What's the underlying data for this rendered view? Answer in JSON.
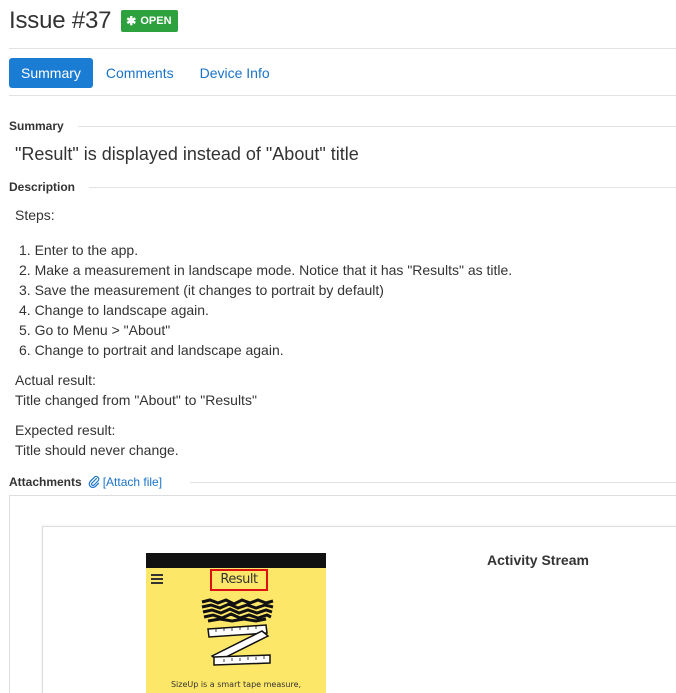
{
  "issue": {
    "title": "Issue #37",
    "status": "OPEN",
    "status_color": "#2ea13f"
  },
  "tabs": [
    {
      "label": "Summary",
      "active": true
    },
    {
      "label": "Comments",
      "active": false
    },
    {
      "label": "Device Info",
      "active": false
    }
  ],
  "summary": {
    "label": "Summary",
    "text": "\"Result\" is displayed instead of \"About\" title"
  },
  "description": {
    "label": "Description",
    "intro": "Steps:",
    "steps": [
      "1. Enter to the app.",
      "2. Make a measurement in landscape mode. Notice that it has \"Results\" as title.",
      "3. Save the measurement (it changes to portrait by default)",
      "4. Change to landscape again.",
      "5. Go to Menu > \"About\"",
      "6. Change to portrait and landscape again."
    ],
    "actual_label": "Actual result:",
    "actual_text": "Title changed from \"About\" to \"Results\"",
    "expected_label": "Expected result:",
    "expected_text": "Title should never change."
  },
  "attachments": {
    "label": "Attachments",
    "attach_link": "[Attach file]",
    "screenshot": {
      "phone_title": "Result",
      "caption": "SizeUp is a smart tape measure,"
    },
    "activity_title": "Activity Stream"
  },
  "colors": {
    "accent": "#1b7cd3",
    "link": "#1a73c8",
    "phone_bg": "#fde768",
    "highlight": "#dd1111"
  }
}
